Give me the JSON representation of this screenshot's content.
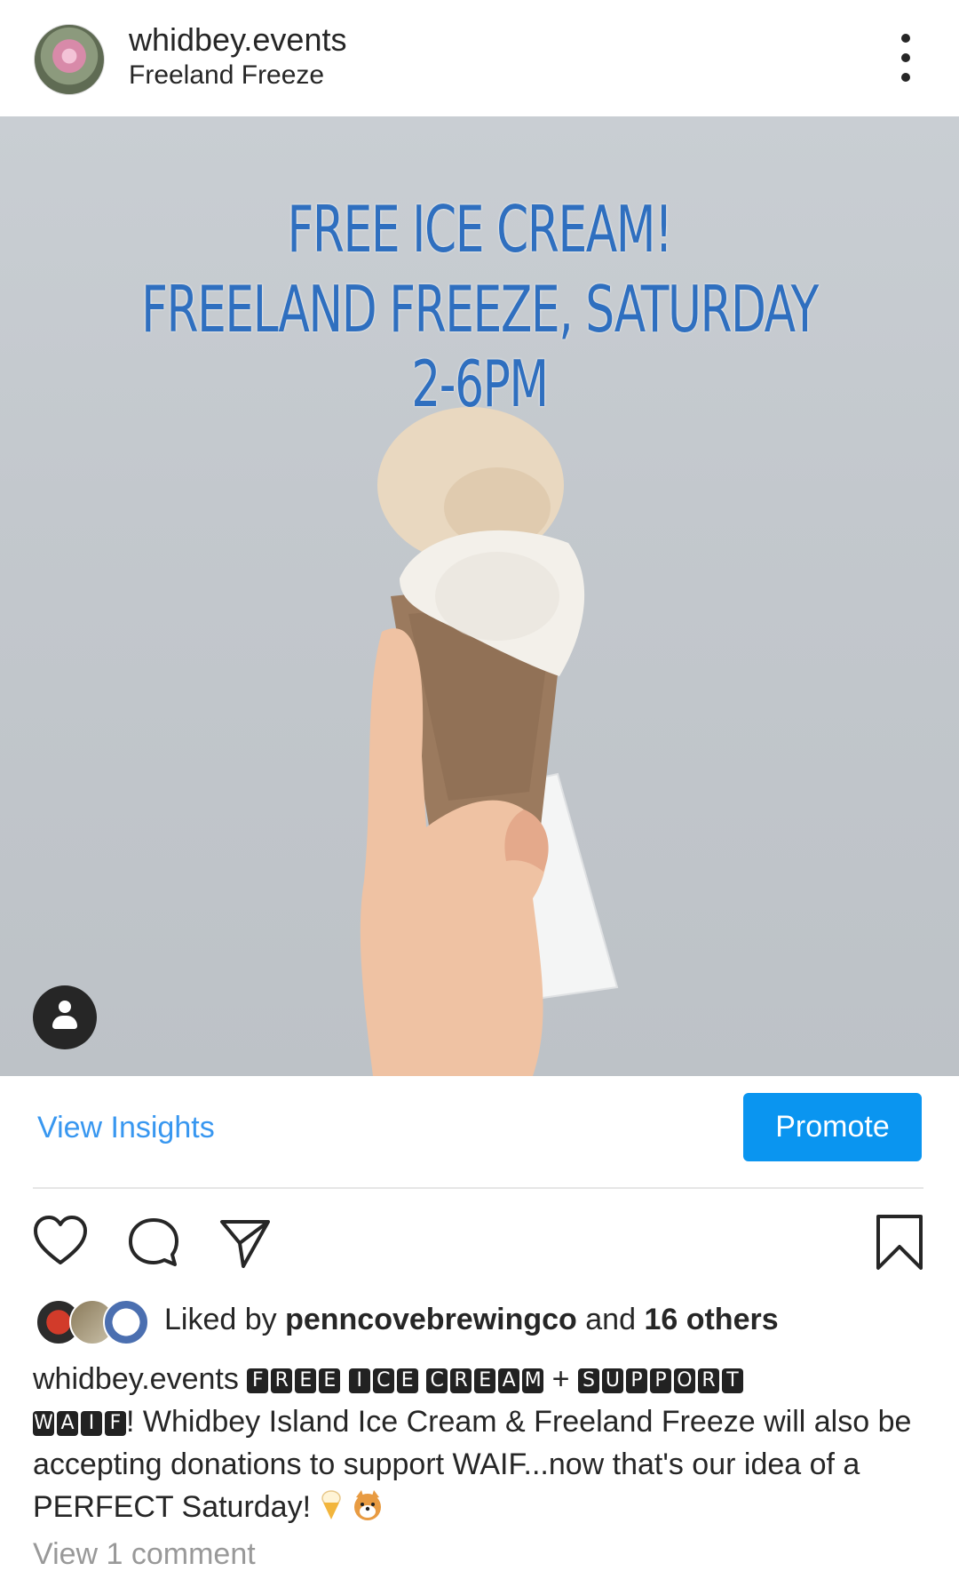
{
  "header": {
    "username": "whidbey.events",
    "location": "Freeland Freeze"
  },
  "post_image": {
    "overlay_line1": "FREE ICE CREAM!",
    "overlay_line2": "FREELAND FREEZE, SATURDAY 2-6PM"
  },
  "actions": {
    "insights_label": "View Insights",
    "promote_label": "Promote"
  },
  "likes": {
    "prefix": "Liked by ",
    "first_user": "penncovebrewingco",
    "middle": " and ",
    "others": "16 others"
  },
  "caption": {
    "username": "whidbey.events",
    "boxed_words_line1": [
      "FREE",
      "ICE",
      "CREAM"
    ],
    "plus": "+",
    "boxed_word_support": "SUPPORT",
    "boxed_word_waif": "WAIF",
    "text": "! Whidbey Island Ice Cream & Freeland Freeze will also be accepting donations to support WAIF...now that's our idea of a PERFECT Saturday!"
  },
  "comments": {
    "view_label": "View 1 comment"
  },
  "colors": {
    "link_blue": "#3897f0",
    "promote_bg": "#0a95f0",
    "overlay_text": "#2f6fbf"
  }
}
